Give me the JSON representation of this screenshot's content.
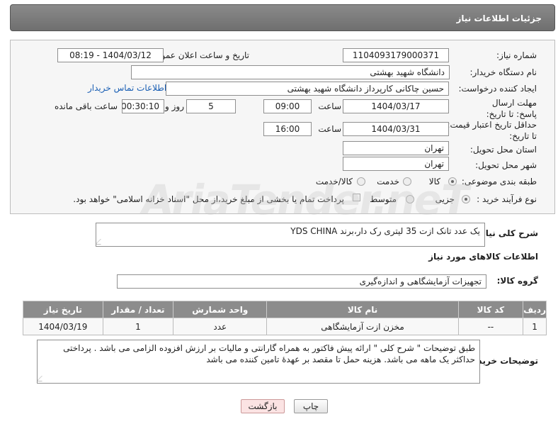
{
  "header": {
    "title": "جزئیات اطلاعات نیاز"
  },
  "form": {
    "need_number_label": "شماره نیاز:",
    "need_number": "1104093179000371",
    "announce_datetime_label": "تاریخ و ساعت اعلان عمومی:",
    "announce_datetime": "1404/03/12 - 08:19",
    "buyer_org_label": "نام دستگاه خریدار:",
    "buyer_org": "دانشگاه شهید بهشتی",
    "requester_label": "ایجاد کننده درخواست:",
    "requester": "حسین چاکانی کارپرداز دانشگاه شهید بهشتی",
    "buyer_contact_link": "اطلاعات تماس خریدار",
    "reply_deadline_label": "مهلت ارسال پاسخ: تا تاریخ:",
    "reply_date": "1404/03/17",
    "time_label": "ساعت",
    "reply_time": "09:00",
    "days_value": "5",
    "days_and_label": "روز و",
    "remaining_time": "00:30:10",
    "remaining_label": "ساعت باقی مانده",
    "price_validity_label": "حداقل تاریخ اعتبار قیمت: تا تاریخ:",
    "price_validity_date": "1404/03/31",
    "price_validity_time": "16:00",
    "delivery_province_label": "استان محل تحویل:",
    "delivery_province": "تهران",
    "delivery_city_label": "شهر محل تحویل:",
    "delivery_city": "تهران",
    "category_label": "طبقه بندی موضوعی:",
    "category_options": [
      "کالا",
      "خدمت",
      "کالا/خدمت"
    ],
    "process_label": "نوع فرآیند خرید :",
    "process_options": [
      "جزیی",
      "متوسط"
    ],
    "payment_note": "پرداخت تمام یا بخشی از مبلغ خرید،از محل \"اسناد خزانه اسلامی\" خواهد بود."
  },
  "description": {
    "label": "شرح کلی نیاز:",
    "text": "یک عدد تانک ازت 35 لیتری رک دار،برند YDS CHINA"
  },
  "goods": {
    "section_title": "اطلاعات کالاهای مورد نیاز",
    "group_label": "گروه کالا:",
    "group_value": "تجهیزات آزمایشگاهی و اندازه‌گیری",
    "columns": [
      "ردیف",
      "کد کالا",
      "نام کالا",
      "واحد شمارش",
      "تعداد / مقدار",
      "تاریخ نیاز"
    ],
    "rows": [
      {
        "row": "1",
        "code": "--",
        "name": "مخزن ازت آزمایشگاهی",
        "unit": "عدد",
        "qty": "1",
        "date": "1404/03/19"
      }
    ]
  },
  "buyer_notes": {
    "label": "توضیحات خریدار:",
    "text": "طبق توضیحات \" شرح کلی \"  ارائه پیش فاکتور به همراه گارانتی و مالیات بر ارزش افزوده الزامی می باشد . پرداختی حداکثر یک ماهه می باشد. هزینه حمل تا مقصد بر عهدهٔ تامین کننده می باشد"
  },
  "buttons": {
    "print": "چاپ",
    "back": "بازگشت"
  },
  "watermark": "AriaTender.neT",
  "colors": {
    "header_bg": "#7d7d7d",
    "table_header_bg": "#8c8c8c",
    "link": "#1a5fb4",
    "back_button_bg": "#fbe3e3"
  }
}
